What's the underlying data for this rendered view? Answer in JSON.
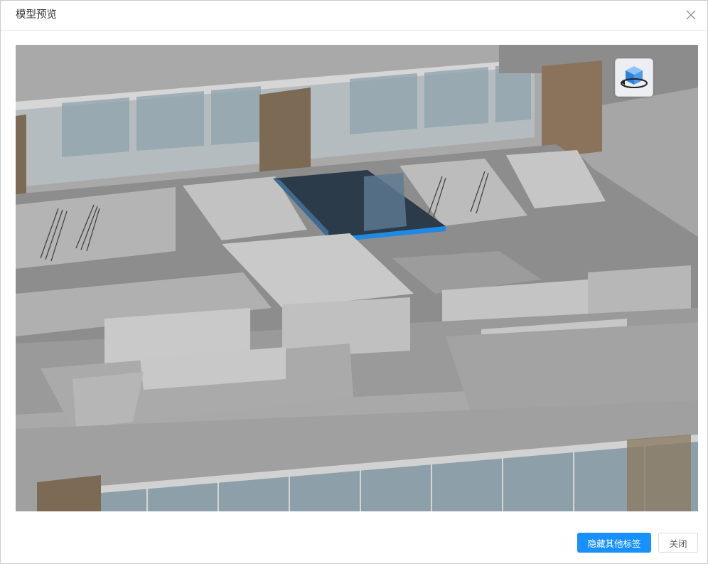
{
  "dialog": {
    "title": "模型预览",
    "close_icon": "close-icon"
  },
  "viewer": {
    "orbit_icon": "cube-orbit-icon",
    "highlight_color": "#1f89e6"
  },
  "footer": {
    "hide_others_label": "隐藏其他标签",
    "close_label": "关闭"
  },
  "colors": {
    "primary": "#1890ff",
    "wall_gray": "#9a9a9a",
    "column_brown": "#7d6a55",
    "glass": "#8fa3ad"
  }
}
